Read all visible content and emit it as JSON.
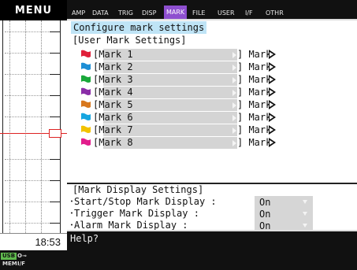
{
  "left_panel": {
    "menu_label": "MENU",
    "clock": "18:53",
    "status_chips": [
      "USB",
      "O⊸",
      "MEM",
      "I/F"
    ]
  },
  "tabs": [
    {
      "label": "AMP",
      "active": false
    },
    {
      "label": "DATA",
      "active": false
    },
    {
      "label": "TRIG",
      "active": false
    },
    {
      "label": "DISP",
      "active": false
    },
    {
      "label": "MARK",
      "active": true
    },
    {
      "label": "FILE",
      "active": false
    },
    {
      "label": "USER",
      "active": false
    },
    {
      "label": "I/F",
      "active": false
    },
    {
      "label": "OTHR",
      "active": false
    }
  ],
  "heading": "Configure mark settings",
  "user_marks": {
    "title": "[User Mark Settings]",
    "items": [
      {
        "flag_color": "#e0203a",
        "label": "[Mark 1",
        "after": "] Mark"
      },
      {
        "flag_color": "#1e8fd6",
        "label": "[Mark 2",
        "after": "] Mark"
      },
      {
        "flag_color": "#19a83a",
        "label": "[Mark 3",
        "after": "] Mark"
      },
      {
        "flag_color": "#8a2ea8",
        "label": "[Mark 4",
        "after": "] Mark"
      },
      {
        "flag_color": "#d8781e",
        "label": "[Mark 5",
        "after": "] Mark"
      },
      {
        "flag_color": "#17a6e0",
        "label": "[Mark 6",
        "after": "] Mark"
      },
      {
        "flag_color": "#f2c200",
        "label": "[Mark 7",
        "after": "] Mark"
      },
      {
        "flag_color": "#e21d8c",
        "label": "[Mark 8",
        "after": "] Mark"
      }
    ]
  },
  "display_settings": {
    "title": "[Mark Display Settings]",
    "rows": [
      {
        "label": "･Start/Stop Mark Display :",
        "value": "On"
      },
      {
        "label": "･Trigger Mark Display :",
        "value": "On"
      },
      {
        "label": "･Alarm Mark Display :",
        "value": "On"
      }
    ]
  },
  "help": "Help?"
}
